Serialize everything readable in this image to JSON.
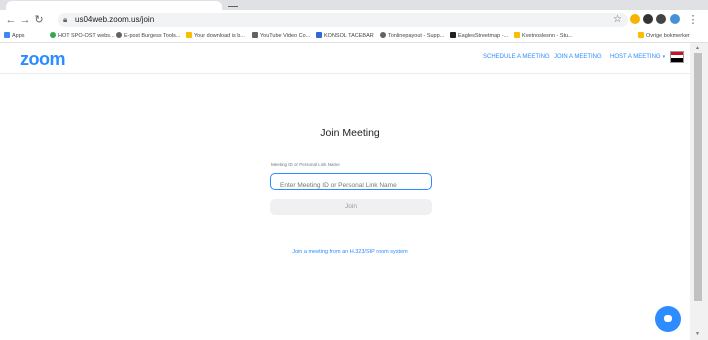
{
  "browser": {
    "url": "us04web.zoom.us/join",
    "bookmarks": [
      {
        "label": "Apps",
        "color": "#4285f4"
      },
      {
        "label": "HOT SPO-OST webs...",
        "color": "#34a853"
      },
      {
        "label": "E-post Burgess Tools...",
        "color": "#5f6368"
      },
      {
        "label": "Your download is b...",
        "color": "#fbbc04"
      },
      {
        "label": "YouTube Video Co...",
        "color": "#5f6368"
      },
      {
        "label": "KONSOL TACEBAR",
        "color": "#3367d6"
      },
      {
        "label": "Tonlinepayout - Supp...",
        "color": "#5f6368"
      },
      {
        "label": "EaglesStreetmap -...",
        "color": "#202124"
      },
      {
        "label": "Kvetnoslesnn - Stu...",
        "color": "#fbbc04"
      },
      {
        "label": "Ovrige bokmerker",
        "color": "#fbbc04"
      }
    ]
  },
  "header": {
    "logo": "zoom",
    "schedule": "SCHEDULE A MEETING",
    "join": "JOIN A MEETING",
    "host": "HOST A MEETING",
    "caret": "▾"
  },
  "main": {
    "title": "Join Meeting",
    "field_label": "Meeting ID or Personal Link Name",
    "field_placeholder": "Enter Meeting ID or Personal Link Name",
    "field_value": "",
    "join_label": "Join",
    "h323_link": "Join a meeting from an H.323/SIP room system"
  },
  "colors": {
    "accent": "#2d8cff"
  }
}
